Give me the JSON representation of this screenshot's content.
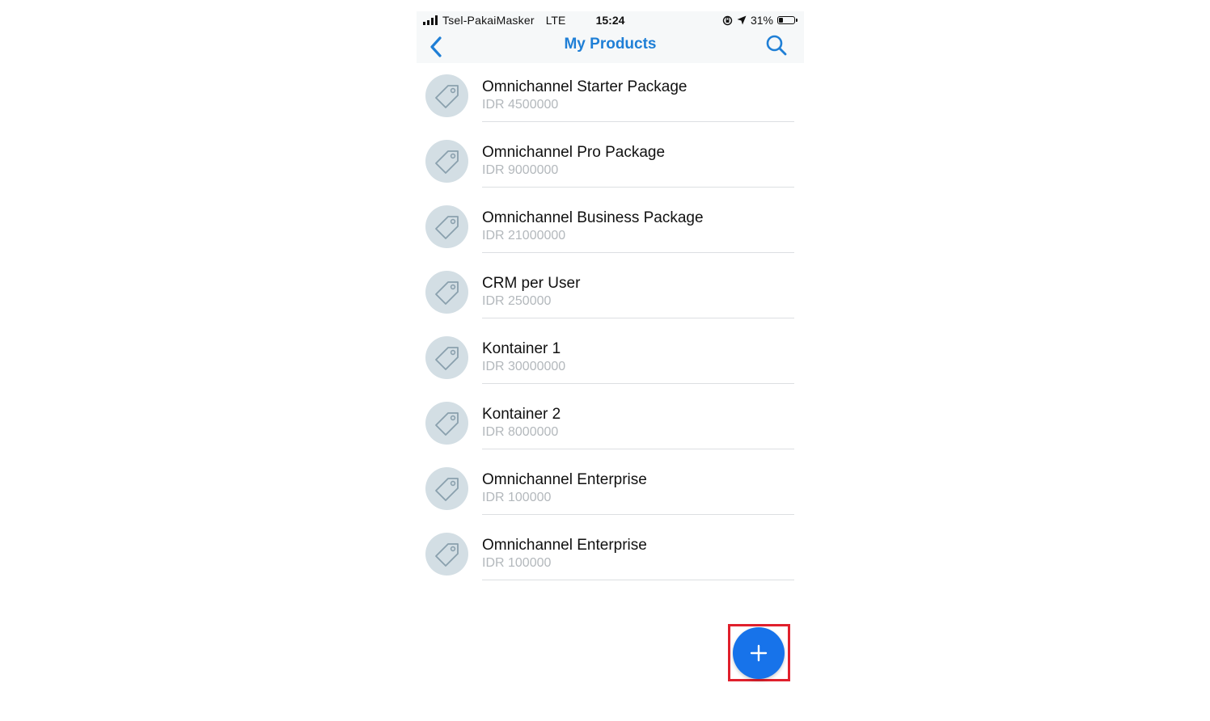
{
  "status_bar": {
    "carrier": "Tsel-PakaiMasker",
    "network": "LTE",
    "time": "15:24",
    "battery": "31%",
    "battery_level": 0.31
  },
  "nav": {
    "title": "My Products",
    "back_icon": "chevron-left-icon",
    "search_icon": "search-icon"
  },
  "products": [
    {
      "name": "Omnichannel Starter Package",
      "price": "IDR 4500000"
    },
    {
      "name": "Omnichannel Pro Package",
      "price": "IDR 9000000"
    },
    {
      "name": "Omnichannel Business Package",
      "price": "IDR 21000000"
    },
    {
      "name": "CRM per User",
      "price": "IDR 250000"
    },
    {
      "name": "Kontainer 1",
      "price": "IDR 30000000"
    },
    {
      "name": "Kontainer 2",
      "price": "IDR 8000000"
    },
    {
      "name": "Omnichannel Enterprise",
      "price": "IDR 100000"
    },
    {
      "name": "Omnichannel Enterprise",
      "price": "IDR 100000"
    }
  ],
  "fab": {
    "icon": "plus-icon"
  },
  "colors": {
    "accent": "#1f7fd6",
    "fab": "#1773ea",
    "highlight": "#e0202c",
    "thumb_bg": "#d3dee4",
    "price_text": "#b3b8bc"
  }
}
